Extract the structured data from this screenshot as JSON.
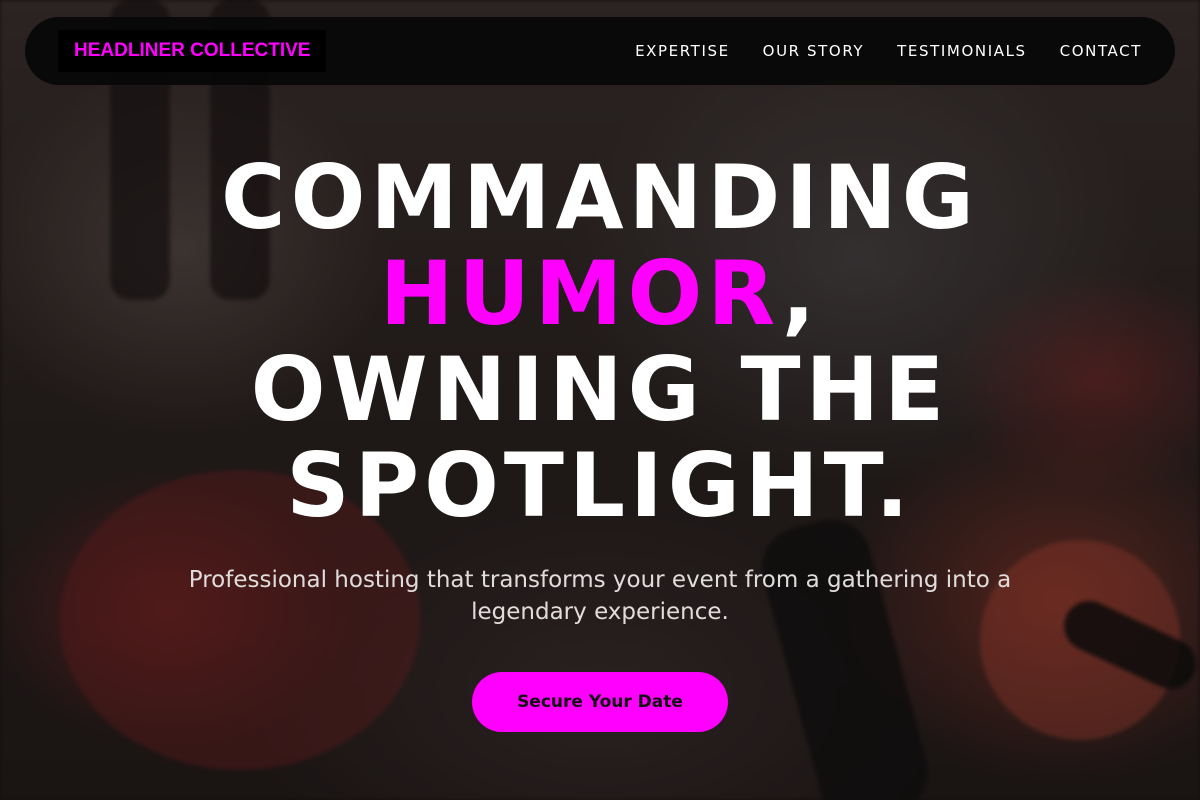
{
  "nav": {
    "brand": "HEADLINER COLLECTIVE",
    "links": [
      "EXPERTISE",
      "OUR STORY",
      "TESTIMONIALS",
      "CONTACT"
    ]
  },
  "hero": {
    "headline_line1": "COMMANDING",
    "headline_accent": "HUMOR",
    "headline_comma": ",",
    "headline_line3": "OWNING THE",
    "headline_line4": "SPOTLIGHT.",
    "subhead": "Professional hosting that transforms your event from a gathering into a legendary experience.",
    "cta_label": "Secure Your Date"
  },
  "colors": {
    "accent": "#ff00ff",
    "nav_bg": "#080808",
    "text": "#ffffff"
  }
}
